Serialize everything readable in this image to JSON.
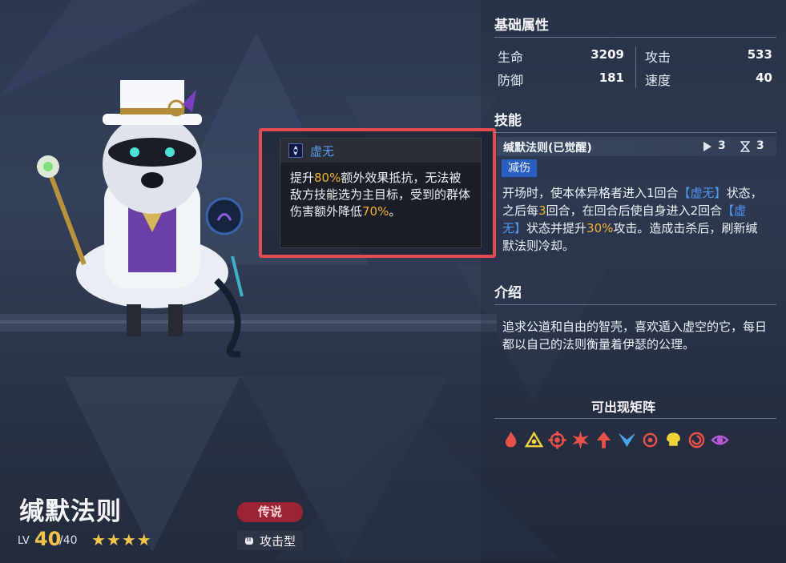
{
  "character": {
    "name": "缄默法则",
    "lv_label": "LV",
    "level": "40",
    "level_max": "/40",
    "stars": "★★★★",
    "rarity": "传说",
    "type": "攻击型"
  },
  "tooltip": {
    "icon": "void-status-icon",
    "title": "虚无",
    "body": [
      {
        "t": "提升"
      },
      {
        "t": "80%",
        "hl": "gold"
      },
      {
        "t": "额外效果抵抗，无法被敌方技能选为主目标，受到的群体伤害额外降低"
      },
      {
        "t": "70%",
        "hl": "gold"
      },
      {
        "t": "。"
      }
    ]
  },
  "attributes": {
    "title": "基础属性",
    "hp_label": "生命",
    "hp": "3209",
    "atk_label": "攻击",
    "atk": "533",
    "def_label": "防御",
    "def": "181",
    "spd_label": "速度",
    "spd": "40"
  },
  "skill": {
    "section_title": "技能",
    "name": "缄默法则(已觉醒)",
    "cost": "3",
    "cooldown": "3",
    "tag": "减伤",
    "desc": [
      {
        "t": "开场时，使本体异格者进入1回合"
      },
      {
        "t": "【虚无】",
        "hl": "blue"
      },
      {
        "t": "状态，之后每"
      },
      {
        "t": "3",
        "hl": "gold"
      },
      {
        "t": "回合，在回合后使自身进入2回合"
      },
      {
        "t": "【虚无】",
        "hl": "blue"
      },
      {
        "t": "状态并提升"
      },
      {
        "t": "30%",
        "hl": "gold"
      },
      {
        "t": "攻击。造成击杀后，刷新缄默法则冷却。"
      }
    ]
  },
  "intro": {
    "title": "介绍",
    "text": "追求公道和自由的智壳，喜欢遁入虚空的它，每日都以自己的法则衡量着伊瑟的公理。"
  },
  "formations": {
    "title": "可出现矩阵",
    "icons": [
      {
        "name": "flame-formation-icon",
        "color": "#e8504a"
      },
      {
        "name": "triangle-formation-icon",
        "color": "#f2d23a"
      },
      {
        "name": "target-formation-icon",
        "color": "#e8504a"
      },
      {
        "name": "burst-formation-icon",
        "color": "#e8504a"
      },
      {
        "name": "arrow-formation-icon",
        "color": "#e8504a"
      },
      {
        "name": "wing-formation-icon",
        "color": "#4aa3e8"
      },
      {
        "name": "crosshair-formation-icon",
        "color": "#e8504a"
      },
      {
        "name": "skull-formation-icon",
        "color": "#f2d23a"
      },
      {
        "name": "spiral-formation-icon",
        "color": "#e8504a"
      },
      {
        "name": "eye-formation-icon",
        "color": "#b85ad8"
      }
    ]
  }
}
